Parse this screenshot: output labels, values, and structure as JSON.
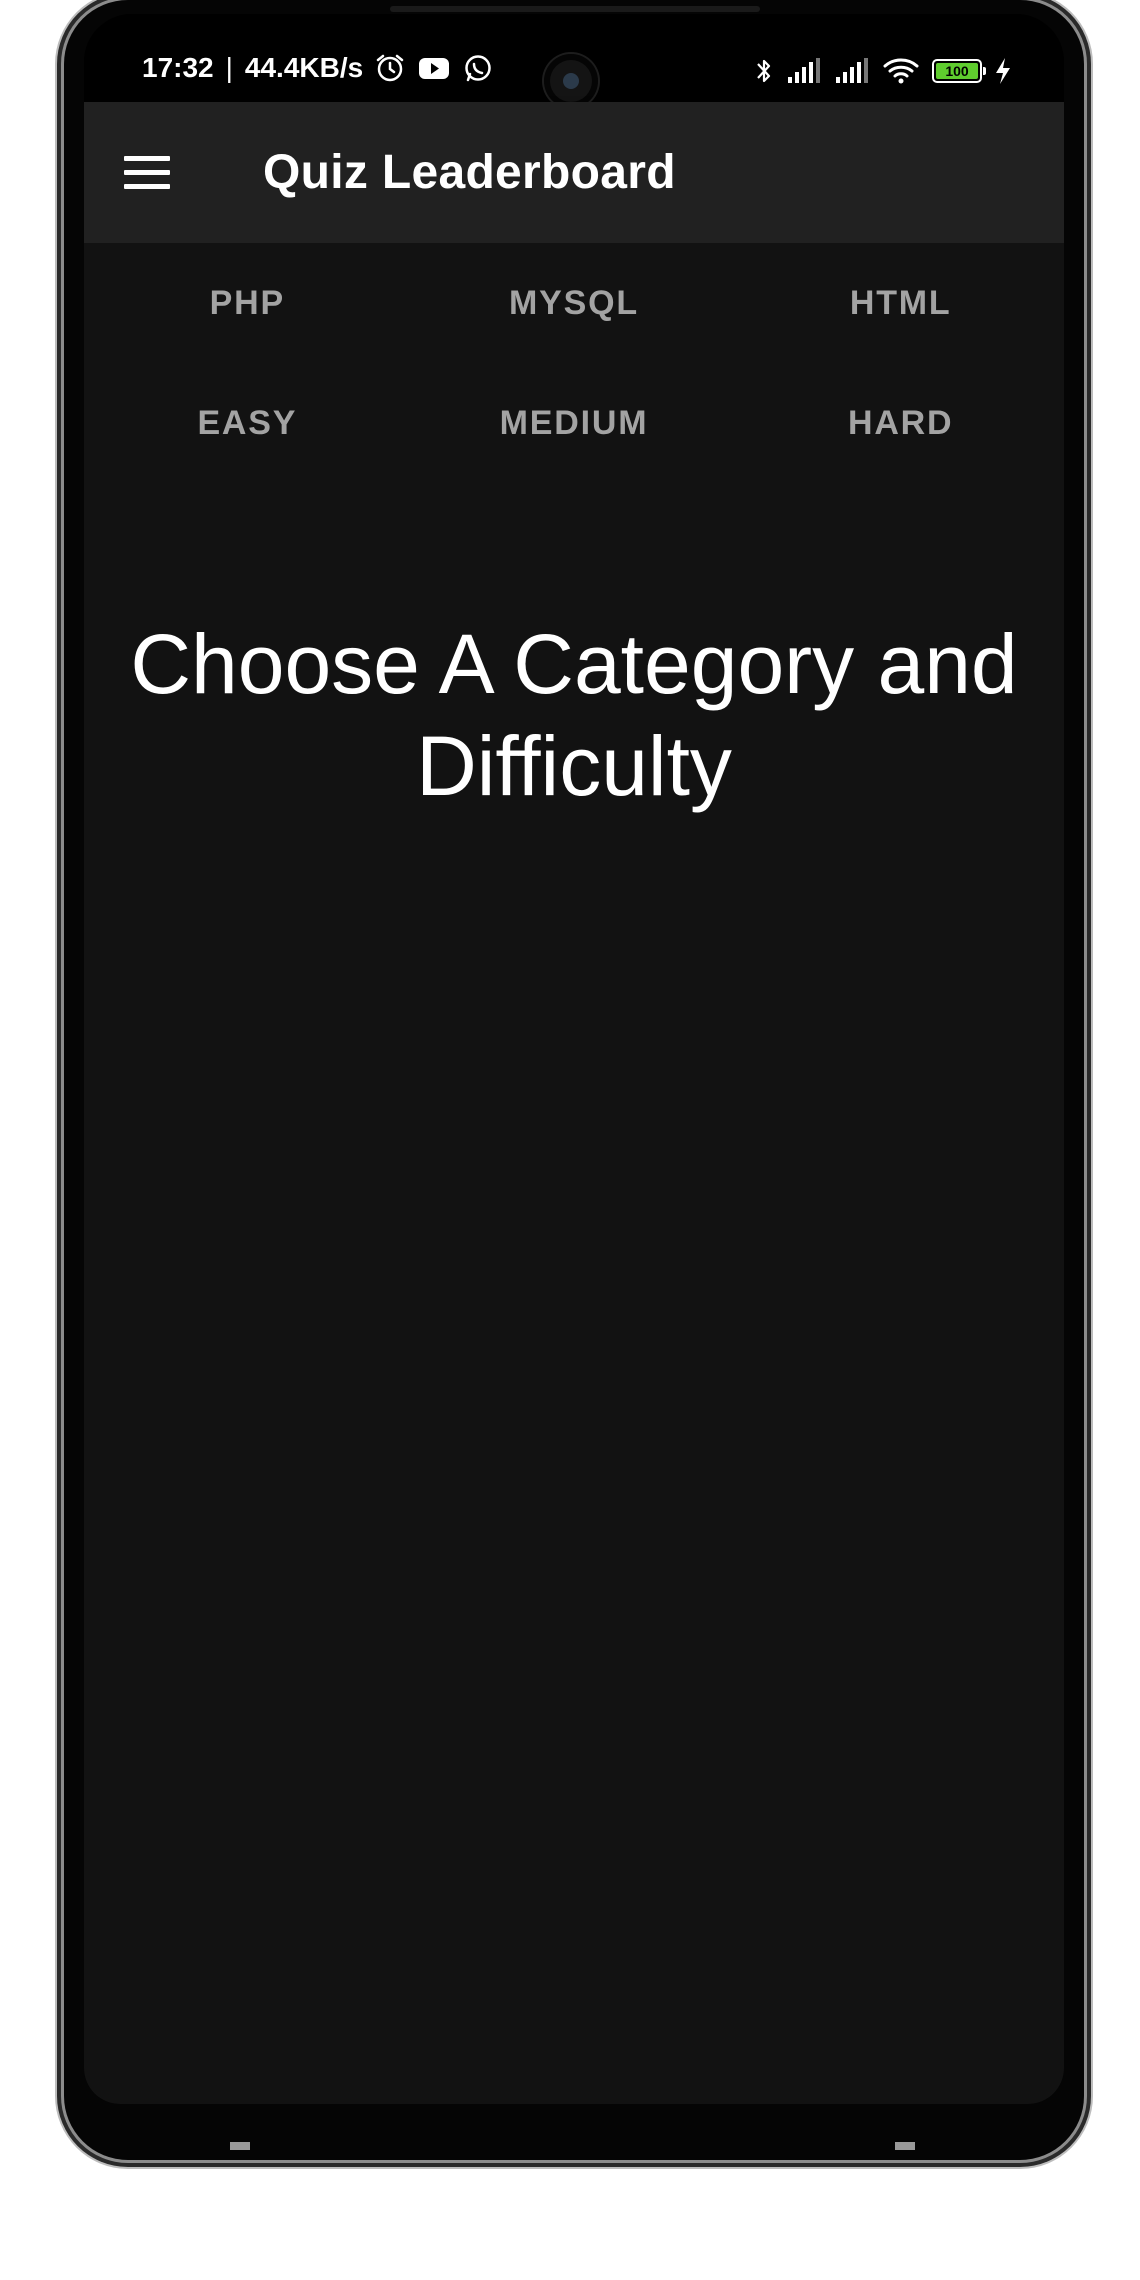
{
  "status_bar": {
    "time": "17:32",
    "separator": "|",
    "network_speed": "44.4KB/s",
    "left_icons": [
      "alarm-icon",
      "youtube-icon",
      "whatsapp-icon"
    ],
    "right_icons": [
      "bluetooth-icon",
      "signal-icon",
      "signal-icon",
      "wifi-icon",
      "battery-icon",
      "charging-icon"
    ],
    "battery_level": "100",
    "battery_color": "#5fcc2e"
  },
  "app_bar": {
    "menu_icon": "hamburger-menu-icon",
    "title": "Quiz Leaderboard",
    "background": "#212121"
  },
  "categories": [
    "PHP",
    "MYSQL",
    "HTML"
  ],
  "difficulties": [
    "EASY",
    "MEDIUM",
    "HARD"
  ],
  "main": {
    "prompt": "Choose A Category and Difficulty",
    "background": "#121212",
    "button_text_color": "#a3a3a3"
  }
}
